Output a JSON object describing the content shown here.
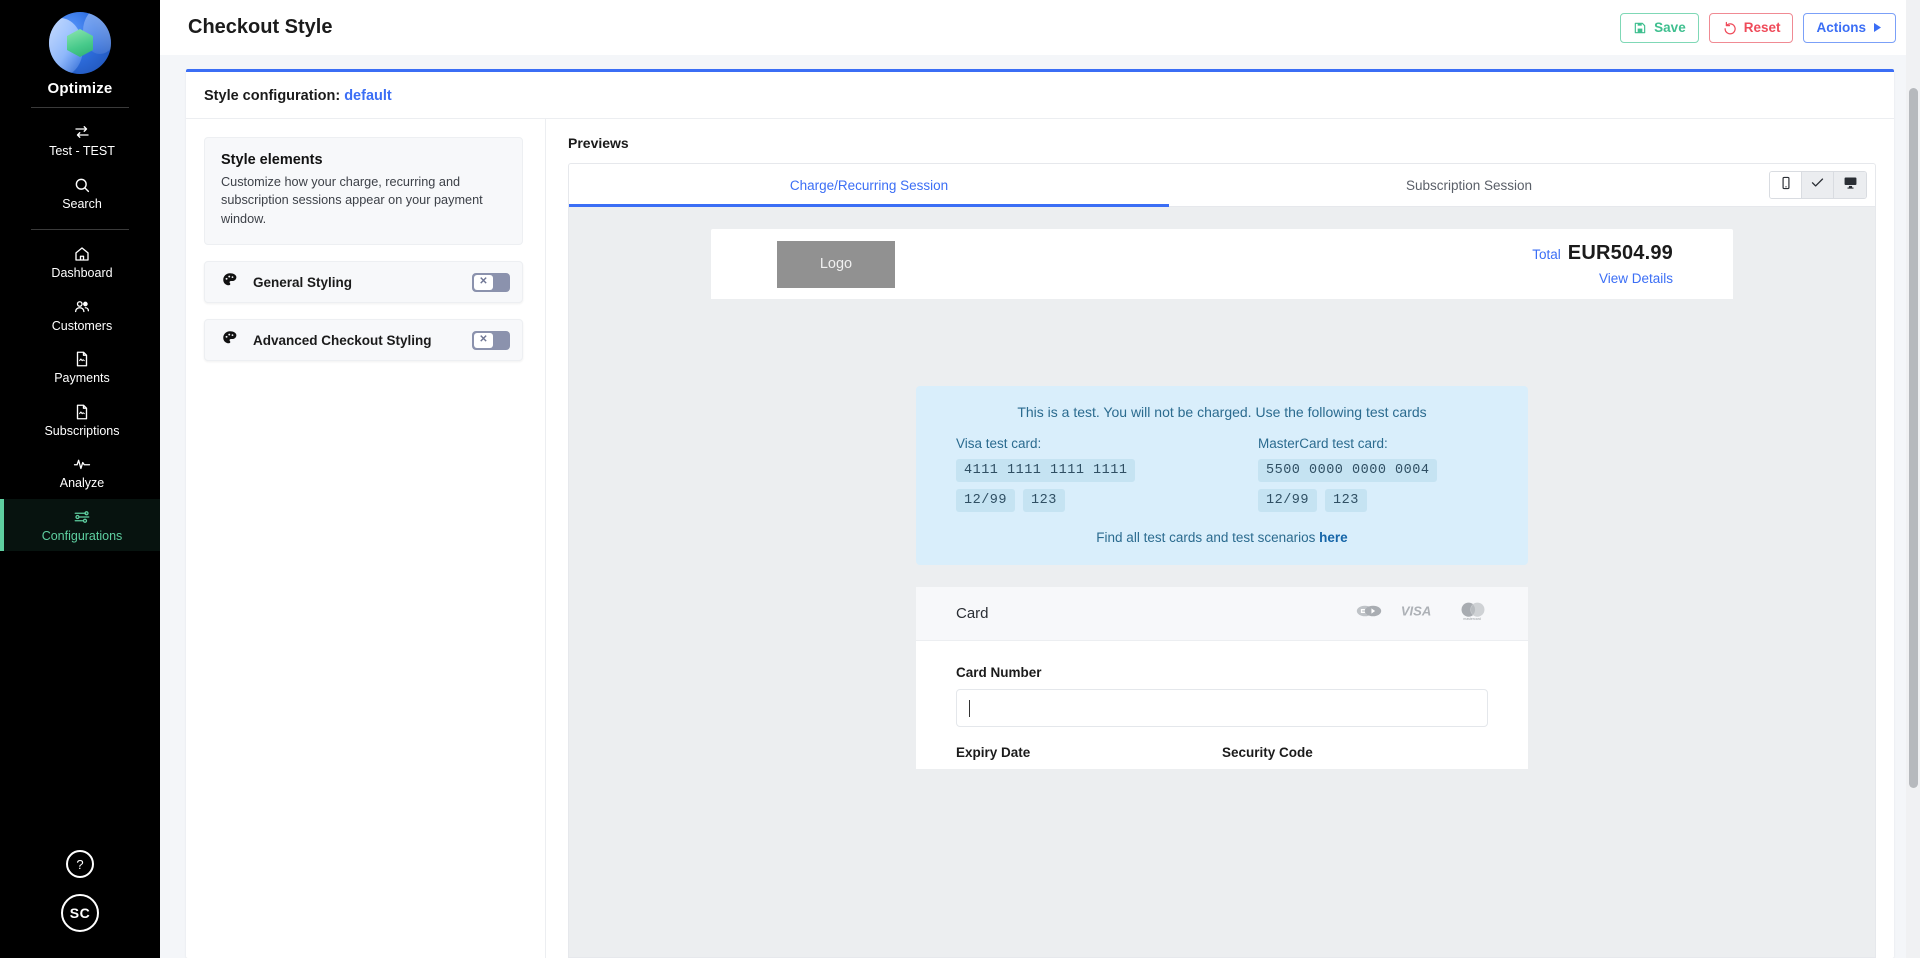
{
  "sidebar": {
    "brand": "Optimize",
    "top_items": [
      {
        "label": "Test - TEST",
        "icon": "swap-arrows-icon"
      },
      {
        "label": "Search",
        "icon": "search-icon"
      }
    ],
    "nav_items": [
      {
        "label": "Dashboard",
        "icon": "home-icon",
        "active": false
      },
      {
        "label": "Customers",
        "icon": "people-icon",
        "active": false
      },
      {
        "label": "Payments",
        "icon": "document-icon",
        "active": false
      },
      {
        "label": "Subscriptions",
        "icon": "document-icon",
        "active": false
      },
      {
        "label": "Analyze",
        "icon": "pulse-icon",
        "active": false
      },
      {
        "label": "Configurations",
        "icon": "sliders-icon",
        "active": true
      }
    ],
    "help_label": "?",
    "avatar_initials": "SC",
    "accent_active": "#5ecfa0"
  },
  "topbar": {
    "title": "Checkout Style",
    "save_label": "Save",
    "reset_label": "Reset",
    "actions_label": "Actions",
    "save_color": "#3fbf8f",
    "reset_color": "#ef4b5a",
    "actions_color": "#3b6ef5"
  },
  "panel": {
    "config_label": "Style configuration:",
    "config_value": "default"
  },
  "style_elements": {
    "title": "Style elements",
    "description": "Customize how your charge, recurring and subscription sessions appear on your payment window.",
    "rows": [
      {
        "label": "General Styling",
        "icon": "palette-icon",
        "toggle_state": "off",
        "toggle_glyph": "✕"
      },
      {
        "label": "Advanced Checkout Styling",
        "icon": "palette-icon",
        "toggle_state": "off",
        "toggle_glyph": "✕"
      }
    ]
  },
  "previews": {
    "title": "Previews",
    "tabs": [
      {
        "label": "Charge/Recurring Session",
        "active": true
      },
      {
        "label": "Subscription Session",
        "active": false
      }
    ],
    "device_buttons": [
      {
        "name": "mobile",
        "icon": "mobile-icon",
        "active": true
      },
      {
        "name": "tablet",
        "icon": "check-icon",
        "active": false
      },
      {
        "name": "desktop",
        "icon": "desktop-icon",
        "active": false
      }
    ]
  },
  "checkout": {
    "logo_text": "Logo",
    "total_label": "Total",
    "total_amount": "EUR504.99",
    "view_details": "View Details",
    "test_notice": {
      "heading": "This is a test. You will not be charged. Use the following test cards",
      "columns": [
        {
          "caption": "Visa test card:",
          "number": "4111 1111 1111 1111",
          "expiry": "12/99",
          "cvc": "123"
        },
        {
          "caption": "MasterCard test card:",
          "number": "5500 0000 0000 0004",
          "expiry": "12/99",
          "cvc": "123"
        }
      ],
      "footer_text": "Find all test cards and test scenarios ",
      "footer_link": "here"
    },
    "card_section": {
      "title": "Card",
      "brands": [
        "dankort-icon",
        "visa-icon",
        "mastercard-icon"
      ],
      "card_number_label": "Card Number",
      "card_number_value": "",
      "expiry_label": "Expiry Date",
      "security_label": "Security Code"
    }
  }
}
